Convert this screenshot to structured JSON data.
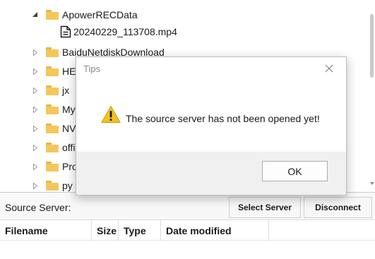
{
  "tree": {
    "items": [
      {
        "label": "ApowerRECData",
        "type": "folder",
        "expanded": true
      },
      {
        "label": "20240229_113708.mp4",
        "type": "file"
      },
      {
        "label": "BaiduNetdiskDownload",
        "type": "folder",
        "expanded": false
      },
      {
        "label": "HEU",
        "type": "folder",
        "expanded": false
      },
      {
        "label": "jx",
        "type": "folder",
        "expanded": false
      },
      {
        "label": "MyI",
        "type": "folder",
        "expanded": false
      },
      {
        "label": "NVI",
        "type": "folder",
        "expanded": false
      },
      {
        "label": "offi",
        "type": "folder",
        "expanded": false
      },
      {
        "label": "Pro",
        "type": "folder",
        "expanded": false
      },
      {
        "label": "py",
        "type": "folder",
        "expanded": false
      }
    ]
  },
  "dialog": {
    "title": "Tips",
    "message": "The source server has not been opened yet!",
    "ok_label": "OK",
    "icon": "warning-icon",
    "close_icon": "close-icon"
  },
  "server_bar": {
    "source_label": "Source Server:",
    "select_label": "Select Server",
    "disconnect_label": "Disconnect"
  },
  "file_table": {
    "columns": [
      "Filename",
      "Size",
      "Type",
      "Date modified"
    ]
  },
  "colors": {
    "folder": "#f4c75c",
    "warning": "#f3c21b",
    "dialog_footer": "#f0f0f0"
  }
}
